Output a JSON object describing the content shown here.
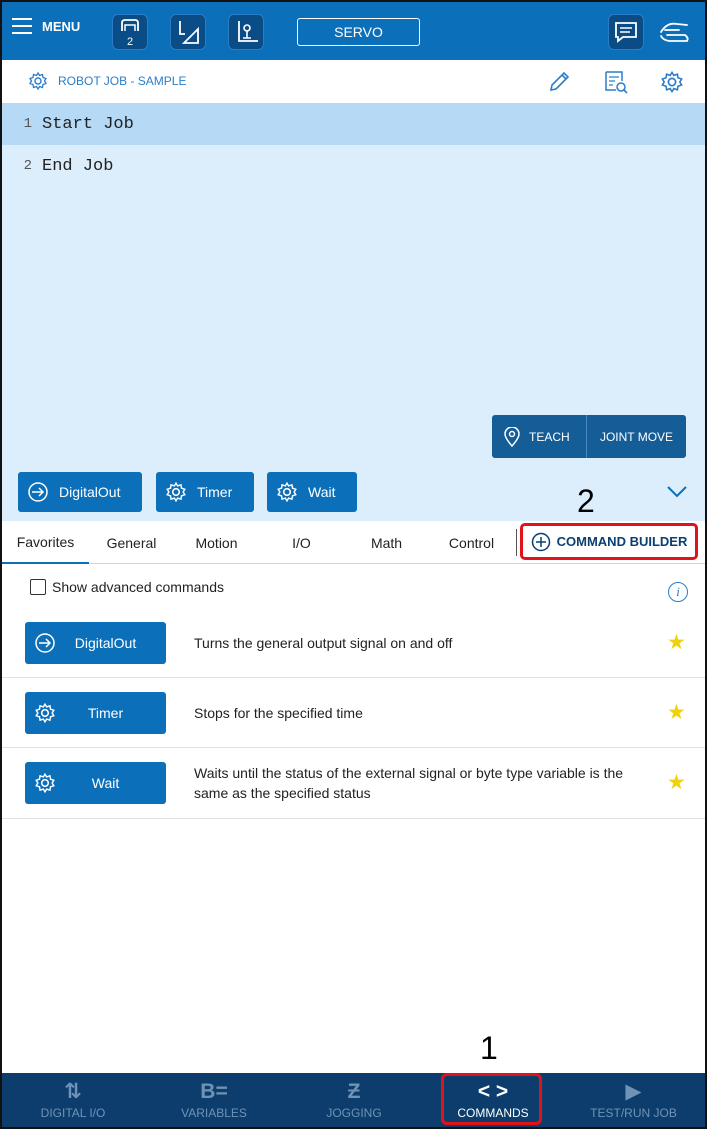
{
  "topbar": {
    "menu_label": "MENU",
    "robot_number": "2",
    "servo_label": "SERVO"
  },
  "job": {
    "title": "ROBOT JOB - SAMPLE",
    "lines": [
      {
        "num": "1",
        "text": "Start Job"
      },
      {
        "num": "2",
        "text": "End Job"
      }
    ]
  },
  "editor_actions": {
    "teach_label": "TEACH",
    "joint_move_label": "JOINT MOVE"
  },
  "quick_commands": [
    "DigitalOut",
    "Timer",
    "Wait"
  ],
  "annotations": {
    "first": "1",
    "second": "2"
  },
  "tabs": [
    "Favorites",
    "General",
    "Motion",
    "I/O",
    "Math",
    "Control"
  ],
  "active_tab": "Favorites",
  "command_builder_label": "COMMAND BUILDER",
  "show_advanced_label": "Show advanced commands",
  "favorites": [
    {
      "name": "DigitalOut",
      "icon": "arrow-in-icon",
      "description": "Turns the general output signal on and off",
      "starred": true
    },
    {
      "name": "Timer",
      "icon": "gear-icon",
      "description": "Stops for the specified time",
      "starred": true
    },
    {
      "name": "Wait",
      "icon": "gear-icon",
      "description": "Waits until the status of the external signal or byte type variable is the same as the specified status",
      "starred": true
    }
  ],
  "bottom_nav": [
    {
      "label": "DIGITAL I/O",
      "icon": "digital-io-icon"
    },
    {
      "label": "VARIABLES",
      "icon": "variables-icon"
    },
    {
      "label": "JOGGING",
      "icon": "jogging-icon"
    },
    {
      "label": "COMMANDS",
      "icon": "commands-icon"
    },
    {
      "label": "TEST/RUN JOB",
      "icon": "play-icon"
    }
  ],
  "colors": {
    "primary": "#0c6fb9",
    "dark_nav": "#0c3d6c",
    "editor_bg": "#dcedfb",
    "highlight": "#e0121a",
    "star": "#f0d20c"
  }
}
